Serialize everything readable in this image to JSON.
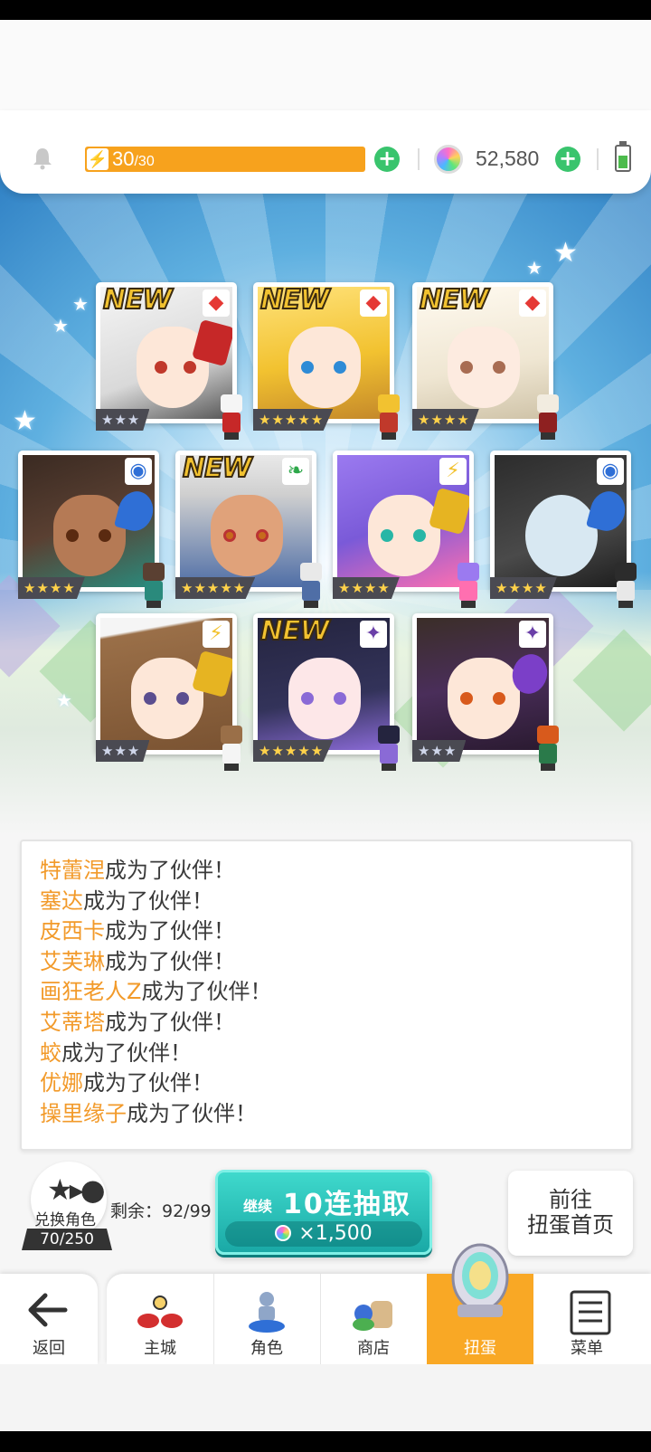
{
  "resources": {
    "stamina_current": "30",
    "stamina_max": "/30",
    "stamina_fill": 1.0,
    "gems": "52,580"
  },
  "cards": [
    {
      "new": true,
      "new_label": "NEW",
      "stars": "★★★",
      "rarity": 3,
      "attr": "red-diamond-icon"
    },
    {
      "new": true,
      "new_label": "NEW",
      "stars": "★★★★★",
      "rarity": 5,
      "attr": "red-diamond-icon"
    },
    {
      "new": true,
      "new_label": "NEW",
      "stars": "★★★★",
      "rarity": 4,
      "attr": "red-diamond-icon"
    },
    {
      "new": false,
      "stars": "★★★★",
      "rarity": 4,
      "attr": "blue-circle-icon"
    },
    {
      "new": true,
      "new_label": "NEW",
      "stars": "★★★★★",
      "rarity": 5,
      "attr": "green-leaf-icon"
    },
    {
      "new": false,
      "stars": "★★★★",
      "rarity": 4,
      "attr": "lightning-icon"
    },
    {
      "new": false,
      "stars": "★★★★",
      "rarity": 4,
      "attr": "blue-circle-icon"
    },
    {
      "new": false,
      "stars": "★★★",
      "rarity": 3,
      "attr": "lightning-icon"
    },
    {
      "new": true,
      "new_label": "NEW",
      "stars": "★★★★★",
      "rarity": 5,
      "attr": "purple-star-icon"
    },
    {
      "new": false,
      "stars": "★★★",
      "rarity": 3,
      "attr": "purple-star-icon"
    }
  ],
  "messages": [
    {
      "name": "特蕾涅",
      "suffix": "成为了伙伴！"
    },
    {
      "name": "塞达",
      "suffix": "成为了伙伴！"
    },
    {
      "name": "皮西卡",
      "suffix": "成为了伙伴！"
    },
    {
      "name": "艾芙琳",
      "suffix": "成为了伙伴！"
    },
    {
      "name": "画狂老人Z",
      "suffix": "成为了伙伴！"
    },
    {
      "name": "艾蒂塔",
      "suffix": "成为了伙伴！"
    },
    {
      "name": "蛟",
      "suffix": "成为了伙伴！"
    },
    {
      "name": "优娜",
      "suffix": "成为了伙伴！"
    },
    {
      "name": "操里缘子",
      "suffix": "成为了伙伴！"
    }
  ],
  "exchange": {
    "label": "兑换角色",
    "count": "70/250"
  },
  "remaining": "剩余：92/99",
  "pull": {
    "continue_label": "继续",
    "main_label": "10连抽取",
    "cost": "×1,500"
  },
  "goto": {
    "line1": "前往",
    "line2": "扭蛋首页"
  },
  "nav": {
    "back": "返回",
    "tabs": [
      "主城",
      "角色",
      "商店",
      "扭蛋",
      "菜单"
    ],
    "active": 3
  }
}
